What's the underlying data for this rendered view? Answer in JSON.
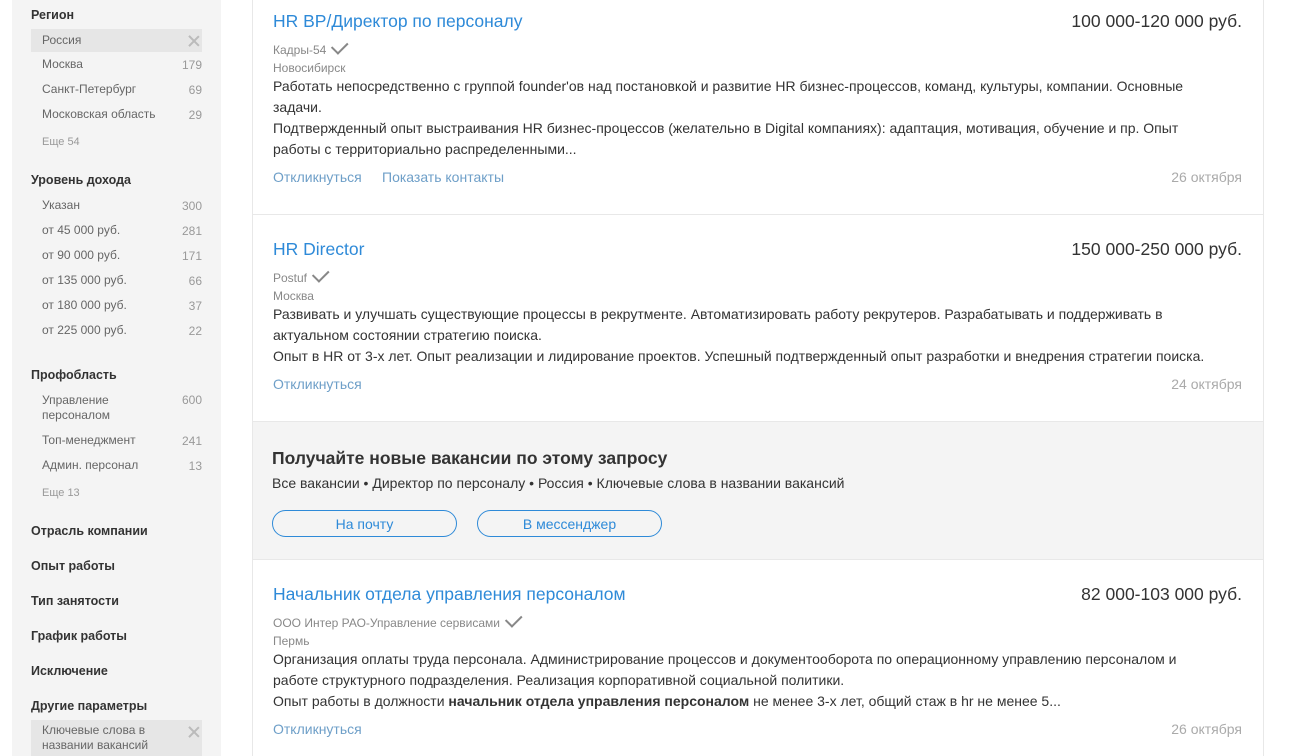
{
  "sidebar": {
    "region": {
      "title": "Регион",
      "items": [
        {
          "label": "Россия",
          "count": ""
        },
        {
          "label": "Москва",
          "count": "179"
        },
        {
          "label": "Санкт-Петербург",
          "count": "69"
        },
        {
          "label": "Московская область",
          "count": "29"
        }
      ],
      "more": "Еще 54"
    },
    "income": {
      "title": "Уровень дохода",
      "items": [
        {
          "label": "Указан",
          "count": "300"
        },
        {
          "label": "от 45 000 руб.",
          "count": "281"
        },
        {
          "label": "от 90 000 руб.",
          "count": "171"
        },
        {
          "label": "от 135 000 руб.",
          "count": "66"
        },
        {
          "label": "от 180 000 руб.",
          "count": "37"
        },
        {
          "label": "от 225 000 руб.",
          "count": "22"
        }
      ]
    },
    "prof": {
      "title": "Профобласть",
      "items": [
        {
          "label": "Управление персоналом",
          "count": "600"
        },
        {
          "label": "Топ-менеджмент",
          "count": "241"
        },
        {
          "label": "Админ. персонал",
          "count": "13"
        }
      ],
      "more": "Еще 13"
    },
    "sections": [
      "Отрасль компании",
      "Опыт работы",
      "Тип занятости",
      "График работы",
      "Исключение",
      "Другие параметры"
    ],
    "other_selected": "Ключевые слова в названии вакансий"
  },
  "vacancies": [
    {
      "title": "HR BP/Директор по персоналу",
      "salary": "100 000-120 000 руб.",
      "company": "Кадры-54",
      "city": "Новосибирск",
      "desc1": "Работать непосредственно с группой founder'ов над постановкой и развитие HR бизнес-процессов, команд, культуры, компании. Основные задачи.",
      "desc2": "Подтвержденный опыт выстраивания HR бизнес-процессов (желательно в Digital компаниях): адаптация, мотивация, обучение и пр. Опыт работы с территориально распределенными...",
      "respond": "Откликнуться",
      "contacts": "Показать контакты",
      "date": "26 октября"
    },
    {
      "title": "HR Director",
      "salary": "150 000-250 000 руб.",
      "company": "Postuf",
      "city": "Москва",
      "desc1": "Развивать и улучшать существующие процессы в рекрутменте. Автоматизировать работу рекрутеров. Разрабатывать и поддерживать в актуальном состоянии стратегию поиска.",
      "desc2": "Опыт в HR от 3-х лет. Опыт реализации и лидирование проектов. Успешный подтвержденный опыт разработки и внедрения стратегии поиска.",
      "respond": "Откликнуться",
      "date": "24 октября"
    },
    {
      "title": "Начальник отдела управления персоналом",
      "salary": "82 000-103 000 руб.",
      "company": "ООО Интер РАО-Управление сервисами",
      "city": "Пермь",
      "desc1": "Организация оплаты труда персонала. Администрирование процессов и документооборота по операционному управлению персоналом и работе структурного подразделения. Реализация корпоративной социальной политики.",
      "desc2_pre": "Опыт работы в должности ",
      "desc2_bold": "начальник отдела управления персоналом",
      "desc2_post": " не менее 3-х лет, общий стаж в hr не менее 5...",
      "respond": "Откликнуться",
      "date": "26 октября"
    }
  ],
  "subscribe": {
    "title": "Получайте новые вакансии по этому запросу",
    "text": "Все вакансии • Директор по персоналу • Россия • Ключевые слова в названии вакансий",
    "email_btn": "На почту",
    "messenger_btn": "В мессенджер"
  }
}
